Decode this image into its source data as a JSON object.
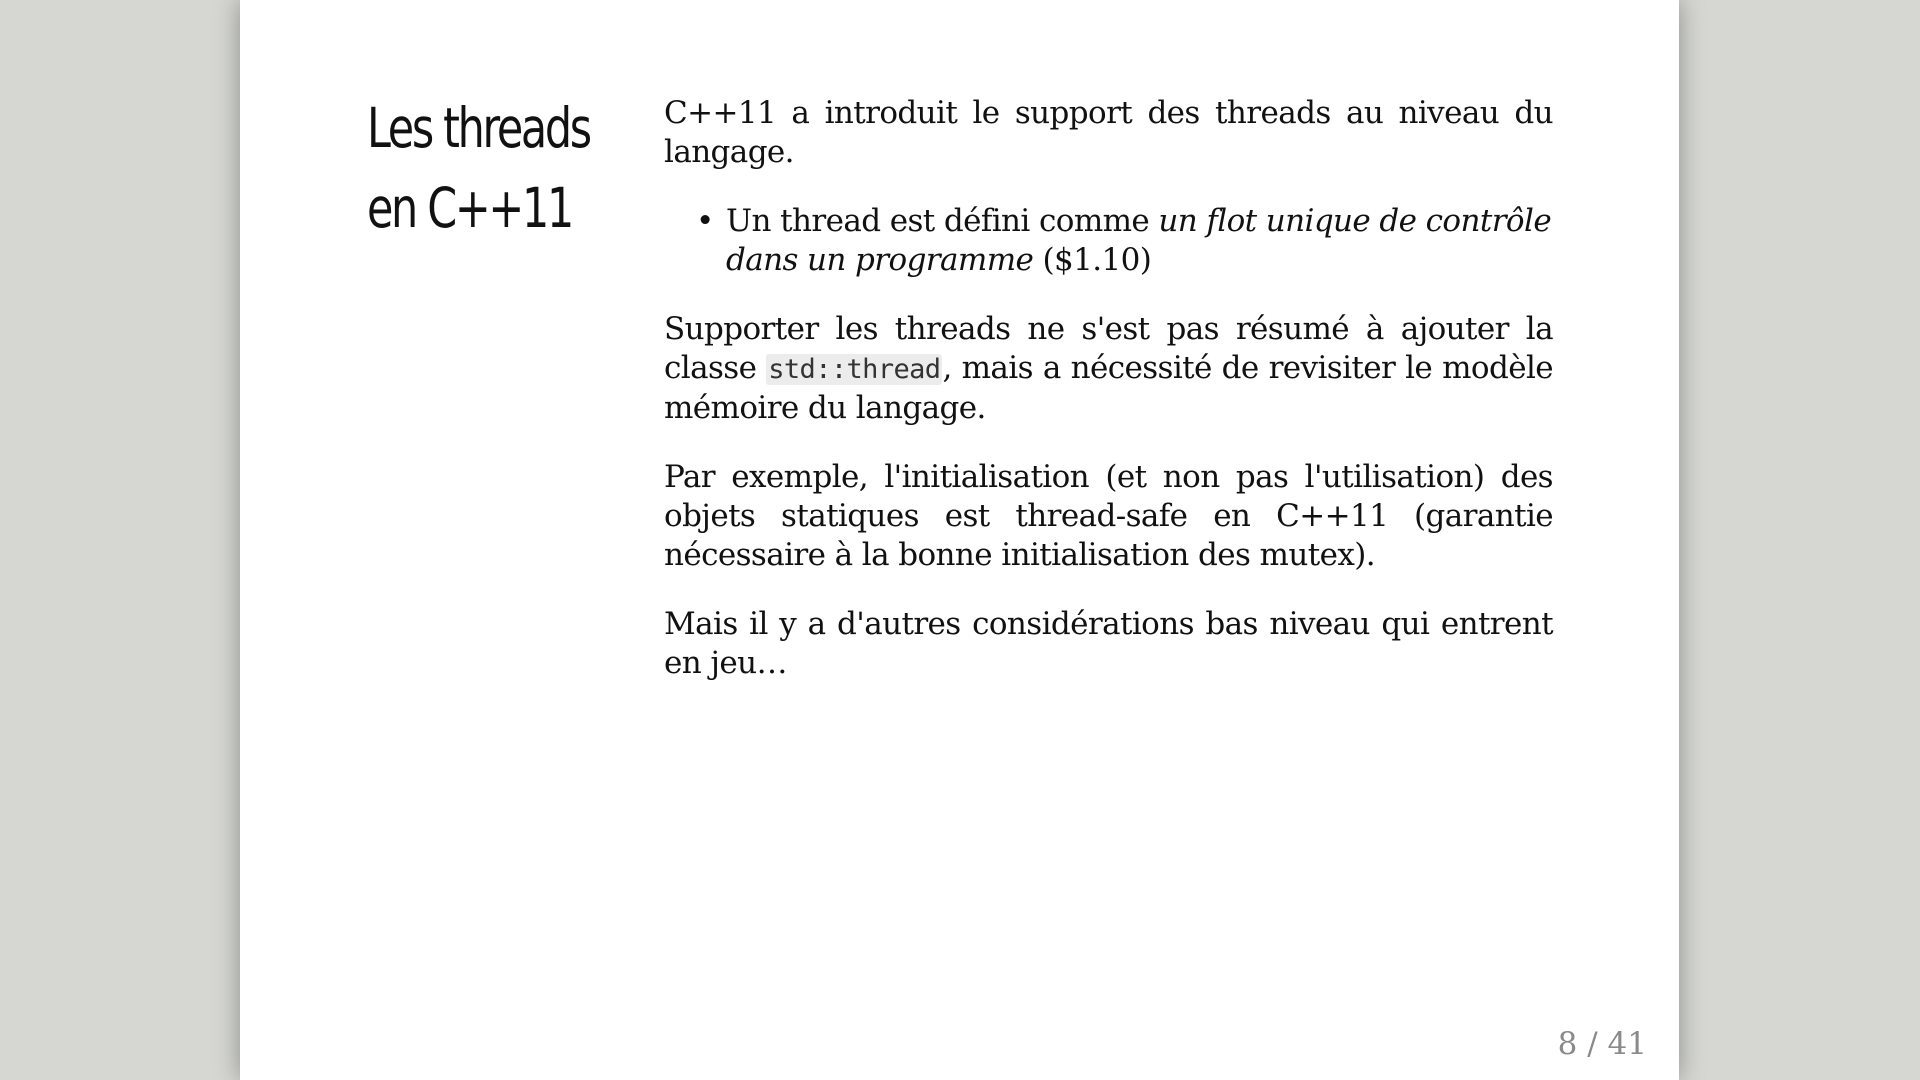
{
  "slide": {
    "title_line1": "Les threads",
    "title_line2": "en C++11",
    "paragraph1": "C++11 a introduit le support des threads au niveau du langage.",
    "bullet": {
      "prefix": "Un thread est défini comme ",
      "emphasis": "un flot unique de contrôle dans un programme",
      "suffix": " ($1.10)"
    },
    "paragraph2": {
      "before_code": "Supporter les threads ne s'est pas résumé à ajouter la classe ",
      "code": "std::thread",
      "after_code": ", mais a nécessité de revisiter le modèle mémoire du langage."
    },
    "paragraph3": "Par exemple, l'initialisation (et non pas l'utilisation) des objets statiques est thread-safe en C++11 (garantie nécessaire à la bonne initialisation des mutex).",
    "paragraph4": "Mais il y a d'autres considérations bas niveau qui entrent en jeu…",
    "page_number": "8 / 41"
  },
  "colors": {
    "background": "#d6d7d2",
    "slide": "#ffffff",
    "text": "#111111",
    "code_background": "#ececec",
    "page_number": "#8a8a8a"
  }
}
